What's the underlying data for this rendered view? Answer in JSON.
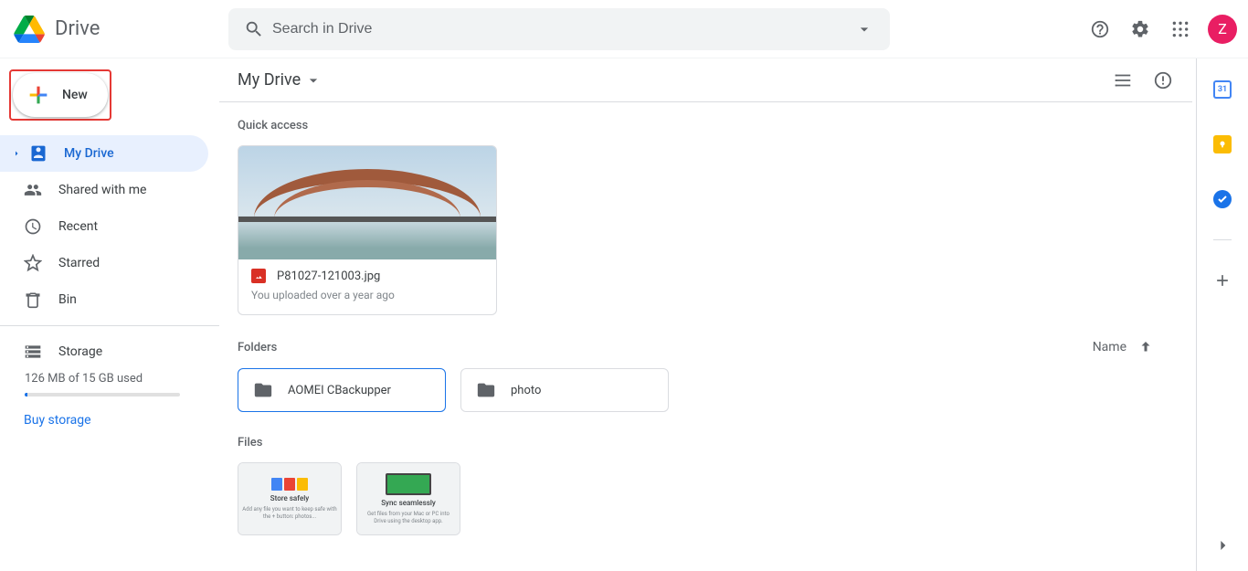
{
  "app": {
    "name": "Drive"
  },
  "search": {
    "placeholder": "Search in Drive"
  },
  "avatar": {
    "initial": "Z"
  },
  "new_button": {
    "label": "New"
  },
  "sidebar": {
    "items": [
      {
        "label": "My Drive"
      },
      {
        "label": "Shared with me"
      },
      {
        "label": "Recent"
      },
      {
        "label": "Starred"
      },
      {
        "label": "Bin"
      }
    ],
    "storage": {
      "label": "Storage",
      "used_text": "126 MB of 15 GB used",
      "buy_label": "Buy storage"
    }
  },
  "breadcrumb": {
    "label": "My Drive"
  },
  "sections": {
    "quick_access": "Quick access",
    "folders": "Folders",
    "files": "Files",
    "sort_label": "Name"
  },
  "quick_access": [
    {
      "name": "P81027-121003.jpg",
      "subtitle": "You uploaded over a year ago"
    }
  ],
  "folders": [
    {
      "name": "AOMEI CBackupper"
    },
    {
      "name": "photo"
    }
  ],
  "file_cards": [
    {
      "title": "Store safely",
      "sub": "Add any file you want to keep safe with the + button: photos..."
    },
    {
      "title": "Sync seamlessly",
      "sub": "Get files from your Mac or PC into Drive using the desktop app."
    }
  ]
}
